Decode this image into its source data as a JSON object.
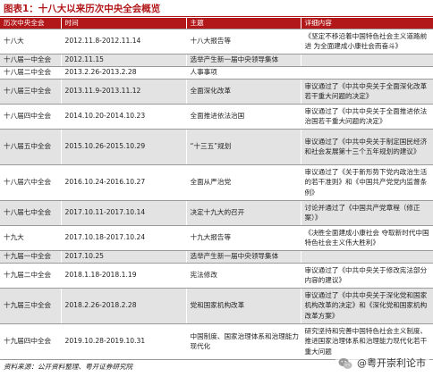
{
  "figure_title": "图表1：十八大以来历次中央全会概览",
  "headers": [
    "历次中央全会",
    "时间",
    "主题",
    "详细内容"
  ],
  "rows": [
    {
      "session": "十八大",
      "time": "2012.11.8-2012.11.14",
      "theme": "十八大报告等",
      "detail": "《坚定不移沿着中国特色社会主义道路前进 为全面建成小康社会而奋斗》"
    },
    {
      "session": "十八届一中全会",
      "time": "2012.11.15",
      "theme": "选举产生新一届中央领导集体",
      "detail": ""
    },
    {
      "session": "十八届二中全会",
      "time": "2013.2.26-2013.2.28",
      "theme": "人事事项",
      "detail": ""
    },
    {
      "session": "十八届三中全会",
      "time": "2013.11.9-2013.11.12",
      "theme": "全面深化改革",
      "detail": "审议通过了《中共中央关于全面深化改革若干重大问题的决定》"
    },
    {
      "session": "十八届四中全会",
      "time": "2014.10.20-2014.10.23",
      "theme": "全面推进依法治国",
      "detail": "审议通过了《中共中央关于全面推进依法治国若干重大问题的决定》"
    },
    {
      "session": "十八届五中全会",
      "time": "2015.10.26-2015.10.29",
      "theme": "“十三五”规划",
      "detail": "审议通过了《中共中央关于制定国民经济和社会发展第十三个五年规划的建议》"
    },
    {
      "session": "十八届六中全会",
      "time": "2016.10.24-2016.10.27",
      "theme": "全面从严治党",
      "detail": "审议通过了《关于新形势下党内政治生活的若干准则》和《中国共产党党内监督条例》"
    },
    {
      "session": "十八届七中全会",
      "time": "2017.10.11-2017.10.14",
      "theme": "决定十九大的召开",
      "detail": "讨论并通过了《中国共产党章程（修正案）》"
    },
    {
      "session": "十九大",
      "time": "2017.10.18-2017.10.24",
      "theme": "十九大报告等",
      "detail": "《决胜全面建成小康社会 夺取新时代中国特色社会主义伟大胜利》"
    },
    {
      "session": "十九届一中全会",
      "time": "2017.10.25",
      "theme": "选举产生新一届中央领导集体",
      "detail": ""
    },
    {
      "session": "十九届二中全会",
      "time": "2018.1.18-2018.1.19",
      "theme": "宪法修改",
      "detail": "审议通过了《中共中央关于修改宪法部分内容的建议》"
    },
    {
      "session": "十九届三中全会",
      "time": "2018.2.26-2018.2.28",
      "theme": "党和国家机构改革",
      "detail": "审议通过了《中共中央关于深化党和国家机构改革的决定》和《深化党和国家机构改革方案》"
    },
    {
      "session": "十九届四中全会",
      "time": "2019.10.28-2019.10.31",
      "theme": "中国制度、国家治理体系和治理能力现代化",
      "detail": "研究坚持和完善中国特色社会主义制度、推进国家治理体系和治理能力现代化若干重大问题"
    }
  ],
  "source_note": "资料来源：公开资料整理、粤开证券研究院",
  "watermark_text": "@粤开崇利论市",
  "colors": {
    "accent": "#b2181a",
    "shaded_row": "#e3e3e3",
    "rule": "#9a9a9a"
  },
  "icons": {
    "watermark": "wechat-icon"
  }
}
